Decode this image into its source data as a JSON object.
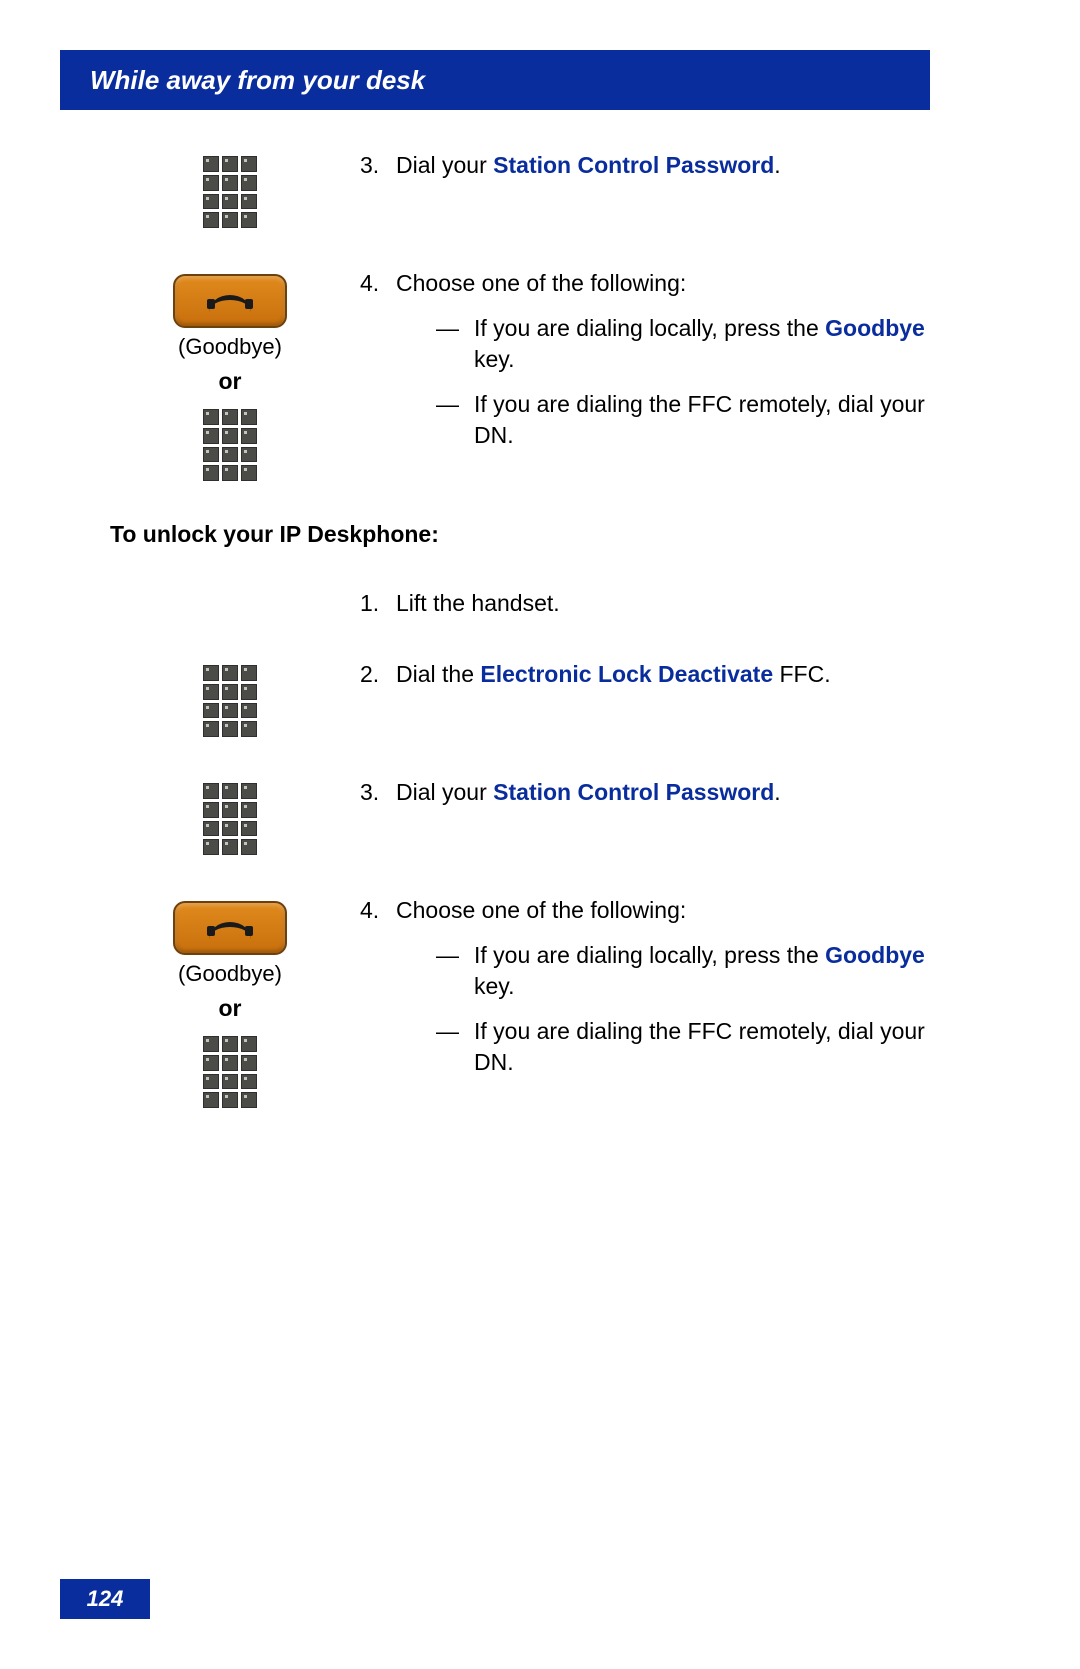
{
  "header": "While away from your desk",
  "page_number": "124",
  "labels": {
    "goodbye_caption": "(Goodbye)",
    "or": "or"
  },
  "section_a": {
    "step3": {
      "num": "3.",
      "prefix": "Dial your ",
      "link": "Station Control Password",
      "suffix": "."
    },
    "step4": {
      "num": "4.",
      "text": "Choose one of the following:",
      "b1_prefix": "If you are dialing locally, press the ",
      "b1_link": "Goodbye",
      "b1_suffix": " key.",
      "b2": "If you are dialing the FFC remotely, dial your DN."
    }
  },
  "unlock_heading": "To unlock your IP Deskphone:",
  "section_b": {
    "step1": {
      "num": "1.",
      "text": "Lift the handset."
    },
    "step2": {
      "num": "2.",
      "prefix": "Dial the ",
      "link": "Electronic Lock Deactivate",
      "suffix": " FFC."
    },
    "step3": {
      "num": "3.",
      "prefix": "Dial your ",
      "link": "Station Control Password",
      "suffix": "."
    },
    "step4": {
      "num": "4.",
      "text": "Choose one of the following:",
      "b1_prefix": "If you are dialing locally, press the ",
      "b1_link": "Goodbye",
      "b1_suffix": " key.",
      "b2": "If you are dialing the FFC remotely, dial your DN."
    }
  }
}
